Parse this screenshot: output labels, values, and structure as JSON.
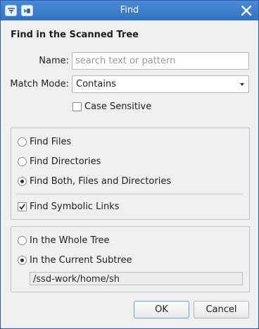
{
  "window": {
    "title": "Find"
  },
  "heading": "Find in the Scanned Tree",
  "name_field": {
    "label": "Name:",
    "placeholder": "search text or pattern",
    "value": ""
  },
  "match_mode": {
    "label": "Match Mode:",
    "selected": "Contains"
  },
  "case_sensitive": {
    "label": "Case Sensitive",
    "checked": false
  },
  "find_type": {
    "options": [
      {
        "label": "Find Files",
        "selected": false
      },
      {
        "label": "Find Directories",
        "selected": false
      },
      {
        "label": "Find Both, Files and Directories",
        "selected": true
      }
    ]
  },
  "symlinks": {
    "label": "Find Symbolic Links",
    "checked": true
  },
  "scope": {
    "options": [
      {
        "label": "In the Whole Tree",
        "selected": false
      },
      {
        "label": "In the Current Subtree",
        "selected": true
      }
    ],
    "path": "/ssd-work/home/sh"
  },
  "buttons": {
    "ok": "OK",
    "cancel": "Cancel"
  },
  "icons": {
    "menu": "window-menu-icon",
    "pin": "pin-icon",
    "close": "close-icon"
  },
  "colors": {
    "titlebar": "#3a78c8",
    "accent": "#6aa0df"
  }
}
